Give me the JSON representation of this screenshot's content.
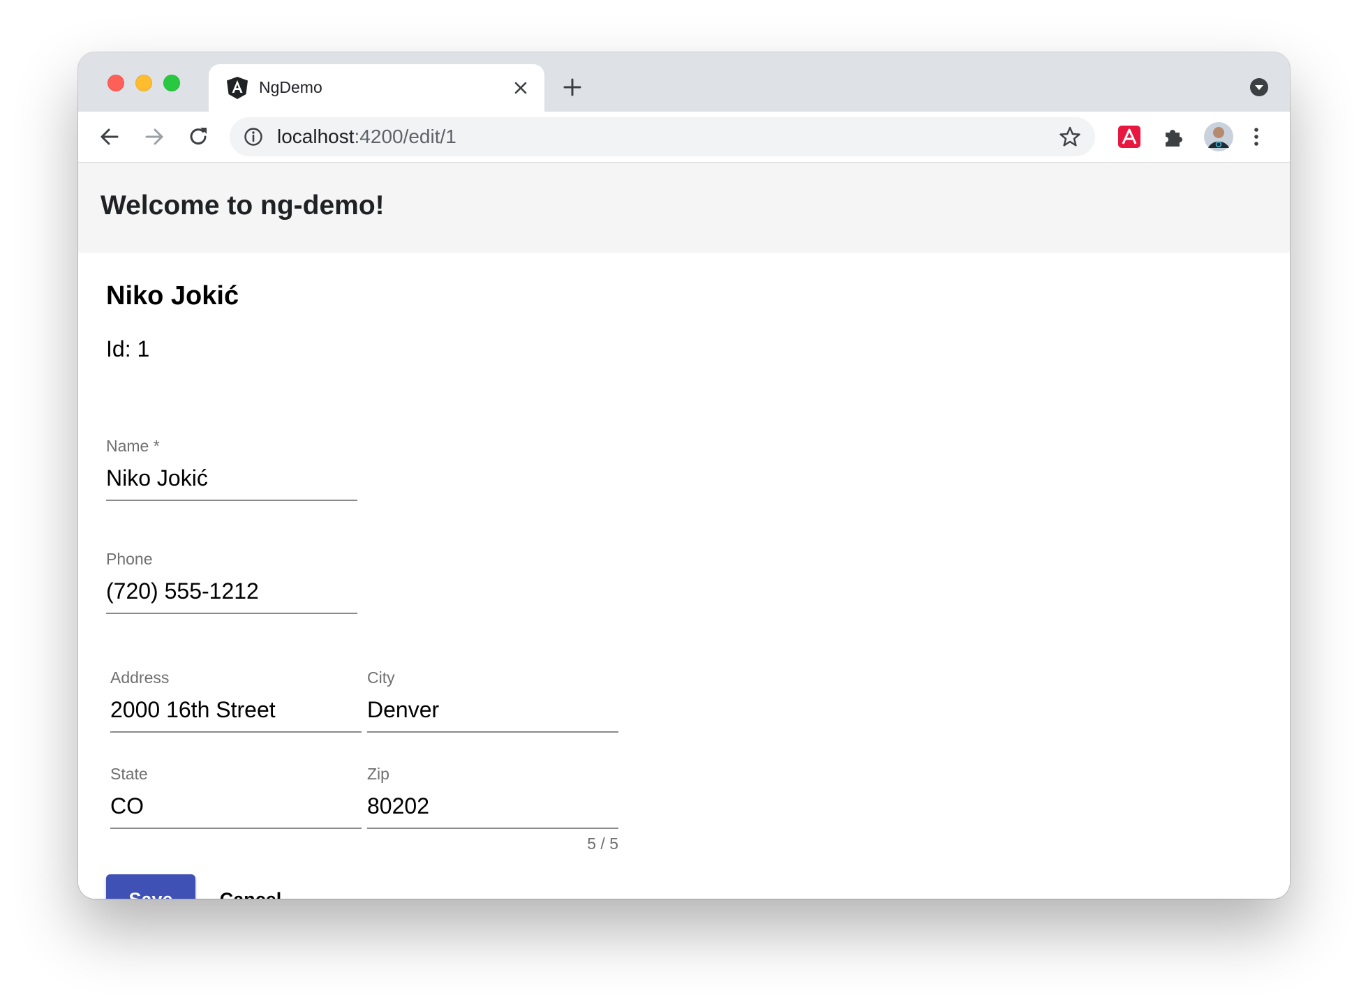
{
  "browser": {
    "tab_title": "NgDemo",
    "url_host": "localhost",
    "url_rest": ":4200/edit/1",
    "icons": {
      "close": "close-icon",
      "new_tab": "plus-icon",
      "back": "arrow-left-icon",
      "forward": "arrow-right-icon",
      "reload": "reload-icon",
      "info": "info-icon",
      "bookmark": "star-icon",
      "extension_red": "angular-devtools-icon",
      "extensions": "puzzle-icon",
      "profile": "avatar",
      "menu": "kebab-menu-icon",
      "tab_search": "tab-search-icon"
    }
  },
  "app": {
    "title": "Welcome to ng-demo!"
  },
  "person": {
    "heading": "Niko Jokić",
    "id_line": "Id: 1"
  },
  "form": {
    "name": {
      "label": "Name *",
      "value": "Niko Jokić"
    },
    "phone": {
      "label": "Phone",
      "value": "(720) 555-1212"
    },
    "address": {
      "label": "Address",
      "value": "2000 16th Street"
    },
    "city": {
      "label": "City",
      "value": "Denver"
    },
    "state": {
      "label": "State",
      "value": "CO"
    },
    "zip": {
      "label": "Zip",
      "value": "80202",
      "hint": "5 / 5"
    }
  },
  "actions": {
    "save_label": "Save",
    "cancel_label": "Cancel"
  },
  "colors": {
    "primary": "#3f51b5",
    "header_bg": "#f5f5f5",
    "tabstrip_bg": "#dee1e6",
    "extension_red": "#e8173f"
  }
}
